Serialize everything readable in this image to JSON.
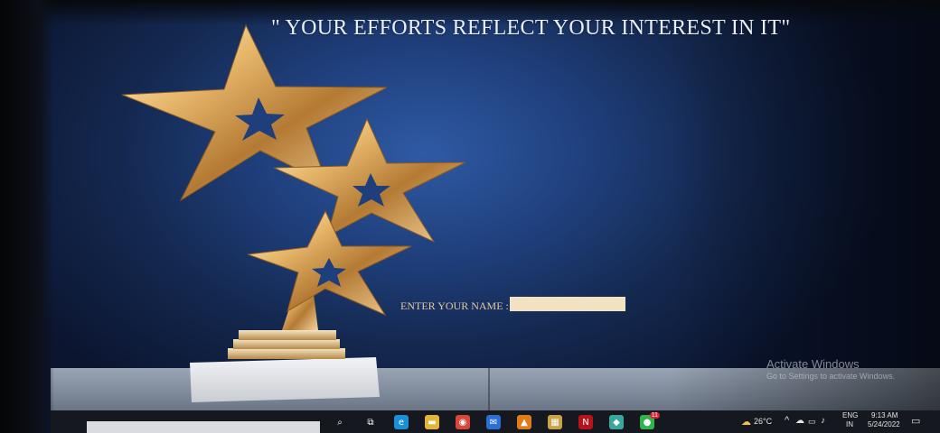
{
  "banner": {
    "quote": "\" YOUR EFFORTS REFLECT YOUR INTEREST IN IT\""
  },
  "form": {
    "name_label": "ENTER YOUR NAME :",
    "name_value": ""
  },
  "watermark": {
    "title": "Activate Windows",
    "subtitle": "Go to Settings to activate Windows."
  },
  "taskbar": {
    "apps": [
      {
        "name": "search-icon",
        "glyph": "⌕",
        "color": "#16181f"
      },
      {
        "name": "task-view-icon",
        "glyph": "⧉",
        "color": "#16181f"
      },
      {
        "name": "edge-icon",
        "glyph": "e",
        "color": "#1b8fd6"
      },
      {
        "name": "file-explorer-icon",
        "glyph": "▬",
        "color": "#e4b53b"
      },
      {
        "name": "chrome-icon",
        "glyph": "◉",
        "color": "#d8473b"
      },
      {
        "name": "mail-icon",
        "glyph": "✉",
        "color": "#2a6fd1"
      },
      {
        "name": "vlc-icon",
        "glyph": "▲",
        "color": "#e07b1a"
      },
      {
        "name": "calendar-icon",
        "glyph": "▦",
        "color": "#c9a24a"
      },
      {
        "name": "netflix-icon",
        "glyph": "N",
        "color": "#b8121a"
      },
      {
        "name": "photos-icon",
        "glyph": "◆",
        "color": "#3aa6a0"
      },
      {
        "name": "whatsapp-icon",
        "glyph": "●",
        "color": "#2fb34a"
      }
    ],
    "notification_count": "11",
    "weather_temp": "26°C",
    "language_top": "ENG",
    "language_bottom": "IN",
    "time": "9:13 AM",
    "date": "5/24/2022"
  }
}
